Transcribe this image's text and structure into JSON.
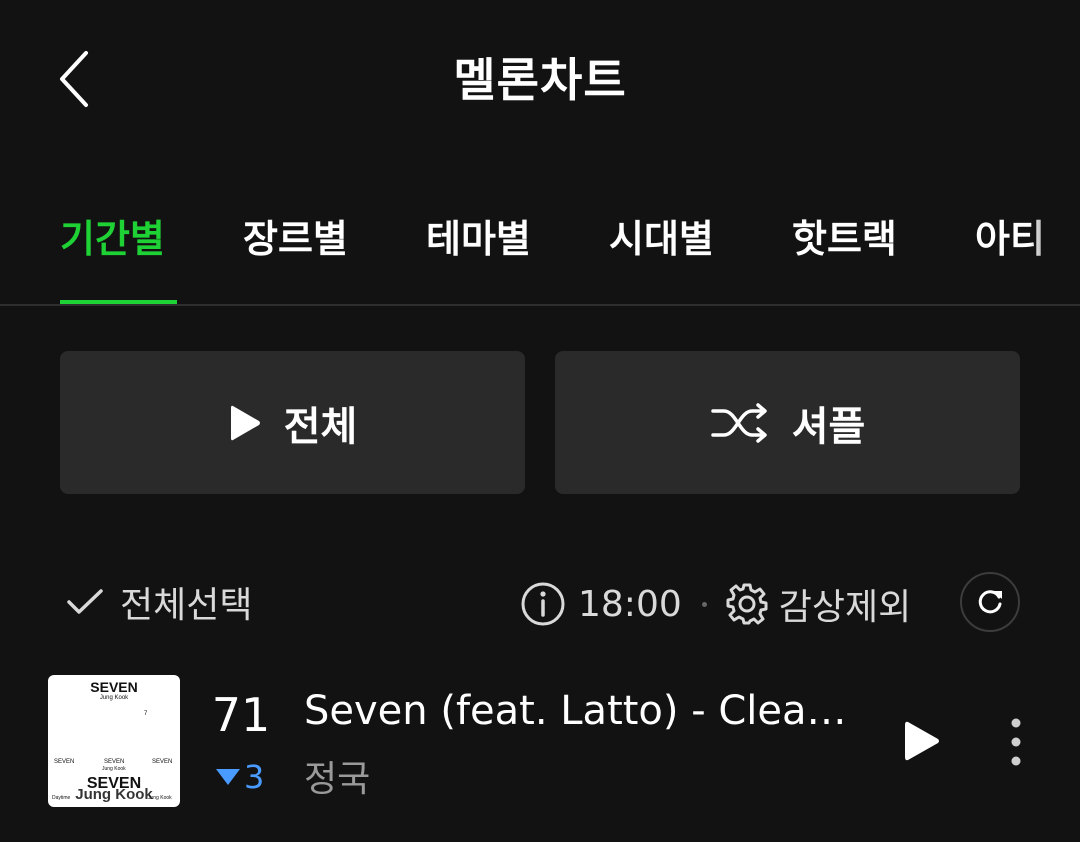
{
  "header": {
    "title": "멜론차트",
    "back_icon": "chevron-left-icon"
  },
  "tabs": [
    {
      "label": "기간별",
      "active": true
    },
    {
      "label": "장르별",
      "active": false
    },
    {
      "label": "테마별",
      "active": false
    },
    {
      "label": "시대별",
      "active": false
    },
    {
      "label": "핫트랙",
      "active": false
    },
    {
      "label": "아티",
      "active": false
    }
  ],
  "actions": {
    "play_all_label": "전체",
    "play_all_icon": "play-icon",
    "shuffle_label": "셔플",
    "shuffle_icon": "shuffle-icon"
  },
  "toolbar": {
    "select_all_label": "전체선택",
    "time": "18:00",
    "exclude_label": "감상제외",
    "info_icon": "info-icon",
    "settings_icon": "gear-icon",
    "refresh_icon": "refresh-icon"
  },
  "songs": [
    {
      "rank": "71",
      "change": "3",
      "change_direction": "down",
      "title": "Seven (feat. Latto) - Clean ...",
      "artist": "정국",
      "album_art": {
        "top_title": "SEVEN",
        "top_sub": "Jung Kook",
        "number": "7",
        "small_left": "SEVEN",
        "small_center": "SEVEN",
        "small_center_sub": "Jung Kook",
        "small_right": "SEVEN",
        "bottom_title": "SEVEN",
        "bottom_overlay": "Jung Kook",
        "bottom_left": "Daytime",
        "bottom_right": "Jung Kook"
      }
    }
  ],
  "colors": {
    "background": "#121212",
    "accent_green": "#1ed135",
    "button_bg": "#2a2a2a",
    "rank_down": "#4a9bff",
    "muted_text": "#9a9a9a"
  }
}
